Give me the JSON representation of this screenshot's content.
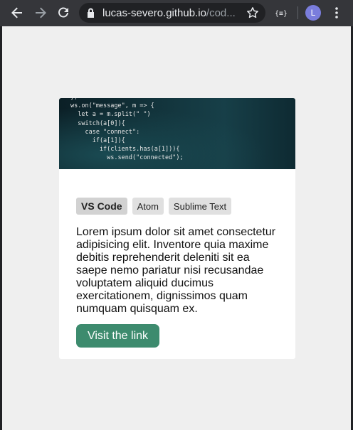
{
  "browser": {
    "url_domain": "lucas-severo.github.io",
    "url_path": "/cod...",
    "profile_initial": "L",
    "icons": {
      "back": "arrow-left-icon",
      "forward": "arrow-right-icon",
      "reload": "reload-icon",
      "lock": "lock-icon",
      "star": "star-icon",
      "extension": "extension-icon",
      "menu": "kebab-menu-icon"
    }
  },
  "card": {
    "image_alt": "code snippet",
    "code_lines": [
      "})",
      "ws.on(\"message\", m => {",
      "  let a = m.split(\" \")",
      "  switch(a[0]){",
      "    case \"connect\":",
      "      if(a[1]){",
      "        if(clients.has(a[1])){",
      "          ws.send(\"connected\");"
    ],
    "tags": [
      "VS Code",
      "Atom",
      "Sublime Text"
    ],
    "description": "Lorem ipsum dolor sit amet consectetur adipisicing elit. Inventore quia maxime debitis reprehenderit deleniti sit ea saepe nemo pariatur nisi recusandae voluptatem aliquid ducimus exercitationem, dignissimos quam numquam quisquam ex.",
    "button_label": "Visit the link"
  },
  "colors": {
    "button": "#3d8b6e",
    "page_background": "#efefef",
    "tab_active": "#d2d2d2",
    "tab_inactive": "#e0e0e0"
  }
}
